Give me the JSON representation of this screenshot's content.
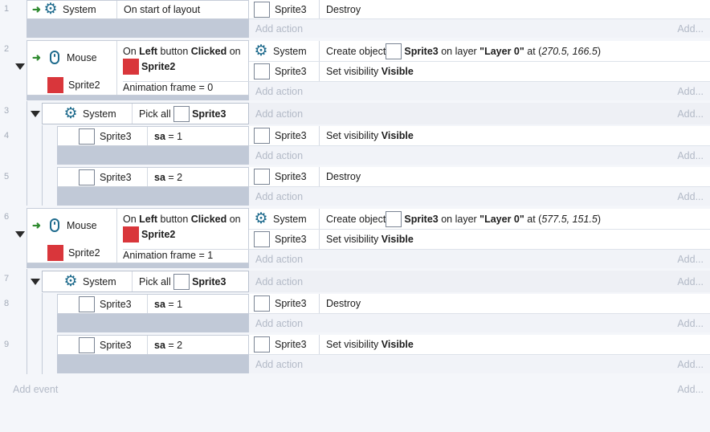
{
  "add_action_label": "Add action",
  "add_more_label": "Add...",
  "add_event_label": "Add event",
  "add_event_more_label": "Add...",
  "sprite2_color": "#d9363b",
  "events": [
    {
      "number": "1",
      "condition": {
        "object": "System",
        "text": "On start of layout"
      },
      "actions": [
        {
          "object": "Sprite3",
          "text": "Destroy"
        }
      ]
    },
    {
      "number": "2",
      "conditions": [
        {
          "object": "Mouse",
          "on": "On ",
          "button": "Left",
          "button_word": " button ",
          "clicked": "Clicked",
          "after": " on",
          "target": "Sprite2"
        },
        {
          "object": "Sprite2",
          "text": "Animation frame = 0"
        }
      ],
      "actions": [
        {
          "object": "System",
          "create": "Create object ",
          "obj": "Sprite3",
          "on_layer": " on layer ",
          "layer": "\"Layer 0\"",
          "at": " at (",
          "coords": "270.5, 166.5",
          "close": ")"
        },
        {
          "object": "Sprite3",
          "set": "Set visibility ",
          "vis": "Visible"
        }
      ]
    },
    {
      "number": "3",
      "condition": {
        "object": "System",
        "pick": "Pick all ",
        "target": "Sprite3"
      }
    },
    {
      "number": "4",
      "condition": {
        "object": "Sprite3",
        "var": "sa",
        "eq": " = 1"
      },
      "actions": [
        {
          "object": "Sprite3",
          "set": "Set visibility ",
          "vis": "Visible"
        }
      ]
    },
    {
      "number": "5",
      "condition": {
        "object": "Sprite3",
        "var": "sa",
        "eq": " = 2"
      },
      "actions": [
        {
          "object": "Sprite3",
          "text": "Destroy"
        }
      ]
    },
    {
      "number": "6",
      "conditions": [
        {
          "object": "Mouse",
          "on": "On ",
          "button": "Left",
          "button_word": " button ",
          "clicked": "Clicked",
          "after": " on",
          "target": "Sprite2"
        },
        {
          "object": "Sprite2",
          "text": "Animation frame = 1"
        }
      ],
      "actions": [
        {
          "object": "System",
          "create": "Create object ",
          "obj": "Sprite3",
          "on_layer": " on layer ",
          "layer": "\"Layer 0\"",
          "at": " at (",
          "coords": "577.5, 151.5",
          "close": ")"
        },
        {
          "object": "Sprite3",
          "set": "Set visibility ",
          "vis": "Visible"
        }
      ]
    },
    {
      "number": "7",
      "condition": {
        "object": "System",
        "pick": "Pick all ",
        "target": "Sprite3"
      }
    },
    {
      "number": "8",
      "condition": {
        "object": "Sprite3",
        "var": "sa",
        "eq": " = 1"
      },
      "actions": [
        {
          "object": "Sprite3",
          "text": "Destroy"
        }
      ]
    },
    {
      "number": "9",
      "condition": {
        "object": "Sprite3",
        "var": "sa",
        "eq": " = 2"
      },
      "actions": [
        {
          "object": "Sprite3",
          "set": "Set visibility ",
          "vis": "Visible"
        }
      ]
    }
  ]
}
